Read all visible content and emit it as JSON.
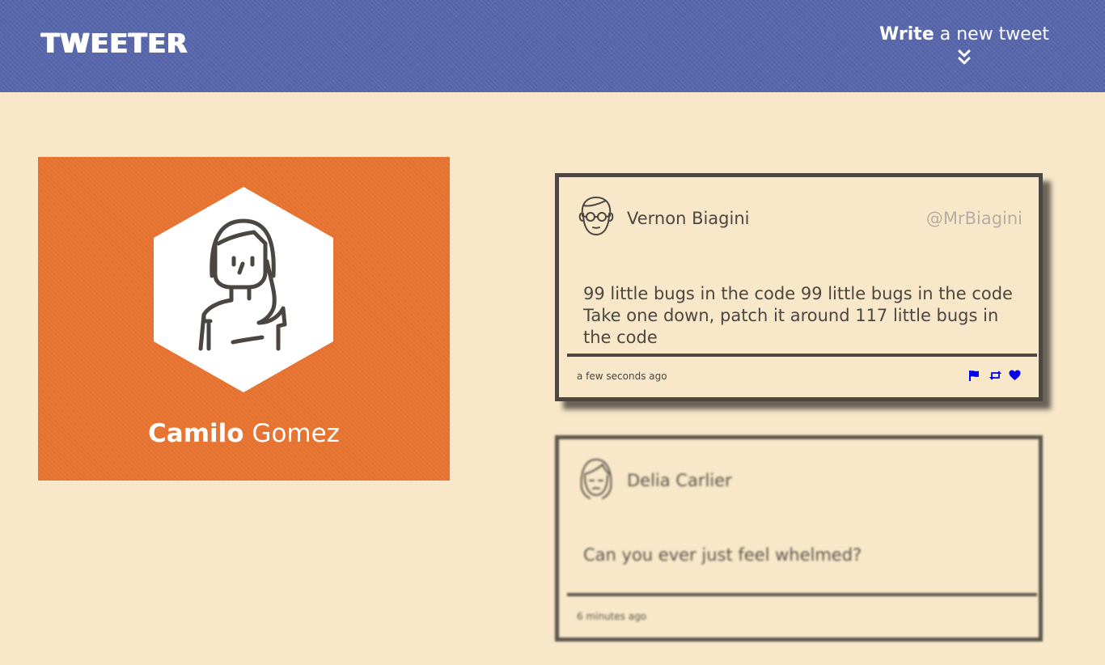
{
  "header": {
    "brand": "TWEETER",
    "compose_bold": "Write",
    "compose_rest": " a new tweet",
    "compose_icon": "double-chevron-down-icon"
  },
  "profile": {
    "first_name": "Camilo",
    "last_name": " Gomez",
    "avatar_icon": "woman-avatar-icon",
    "card_color": "#e87431"
  },
  "tweets": [
    {
      "name": "Vernon Biagini",
      "handle": "@MrBiagini",
      "text": "99 little bugs in the code 99 little bugs in the code Take one down, patch it around 117 little bugs in the code",
      "time": "a few seconds ago",
      "avatar_icon": "man-with-glasses-avatar-icon",
      "actions": [
        "flag-icon",
        "retweet-icon",
        "heart-icon"
      ],
      "action_color": "#0000ee"
    },
    {
      "name": "Delia Carlier",
      "handle": "",
      "text": "Can you ever just feel whelmed?",
      "time": "6 minutes ago",
      "avatar_icon": "woman-avatar-icon"
    }
  ],
  "colors": {
    "background": "#f8e8c9",
    "header": "#5766ad",
    "border": "#4b4640",
    "handle": "#b5ada3"
  }
}
